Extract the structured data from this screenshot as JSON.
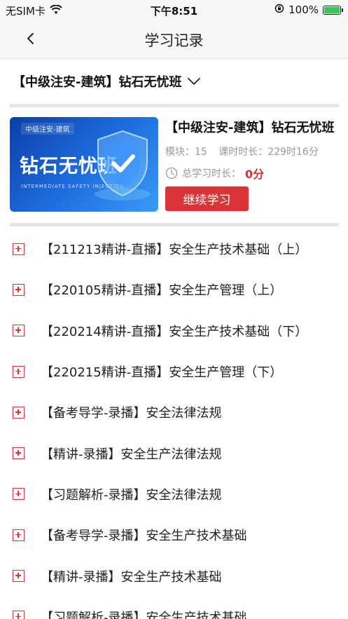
{
  "status_bar": {
    "carrier": "无SIM卡",
    "time": "下午8:51",
    "battery": "100%",
    "icons": [
      "wifi-icon",
      "rotation-lock-icon",
      "battery-charging-icon"
    ]
  },
  "nav": {
    "title": "学习记录",
    "back_icon": "chevron-left-icon"
  },
  "course_selector": {
    "label": "【中级注安-建筑】钻石无忧班",
    "icon": "chevron-down-icon"
  },
  "course_card": {
    "banner_tag": "中级注安-建筑",
    "banner_title": "钻石无忧班",
    "banner_subtitle": "INTERMEDIATE SAFETY INJECTION",
    "title": "【中级注安-建筑】钻石无忧班",
    "modules": "模块：15",
    "duration": "课时时长：229时16分",
    "study_time_label": "总学习时长：",
    "study_time_value": "0分",
    "continue_label": "继续学习"
  },
  "chapters": [
    {
      "label": "【211213精讲-直播】安全生产技术基础（上）"
    },
    {
      "label": "【220105精讲-直播】安全生产管理（上）"
    },
    {
      "label": "【220214精讲-直播】安全生产技术基础（下）"
    },
    {
      "label": "【220215精讲-直播】安全生产管理（下）"
    },
    {
      "label": "【备考导学-录播】安全法律法规"
    },
    {
      "label": "【精讲-录播】安全生产法律法规"
    },
    {
      "label": "【习题解析-录播】安全法律法规"
    },
    {
      "label": "【备考导学-录播】安全生产技术基础"
    },
    {
      "label": "【精讲-录播】安全生产技术基础"
    },
    {
      "label": "【习题解析-录播】安全生产技术基础"
    }
  ],
  "colors": {
    "accent": "#d93436",
    "muted_text": "#999999",
    "banner_blue": "#1f6fe0"
  }
}
